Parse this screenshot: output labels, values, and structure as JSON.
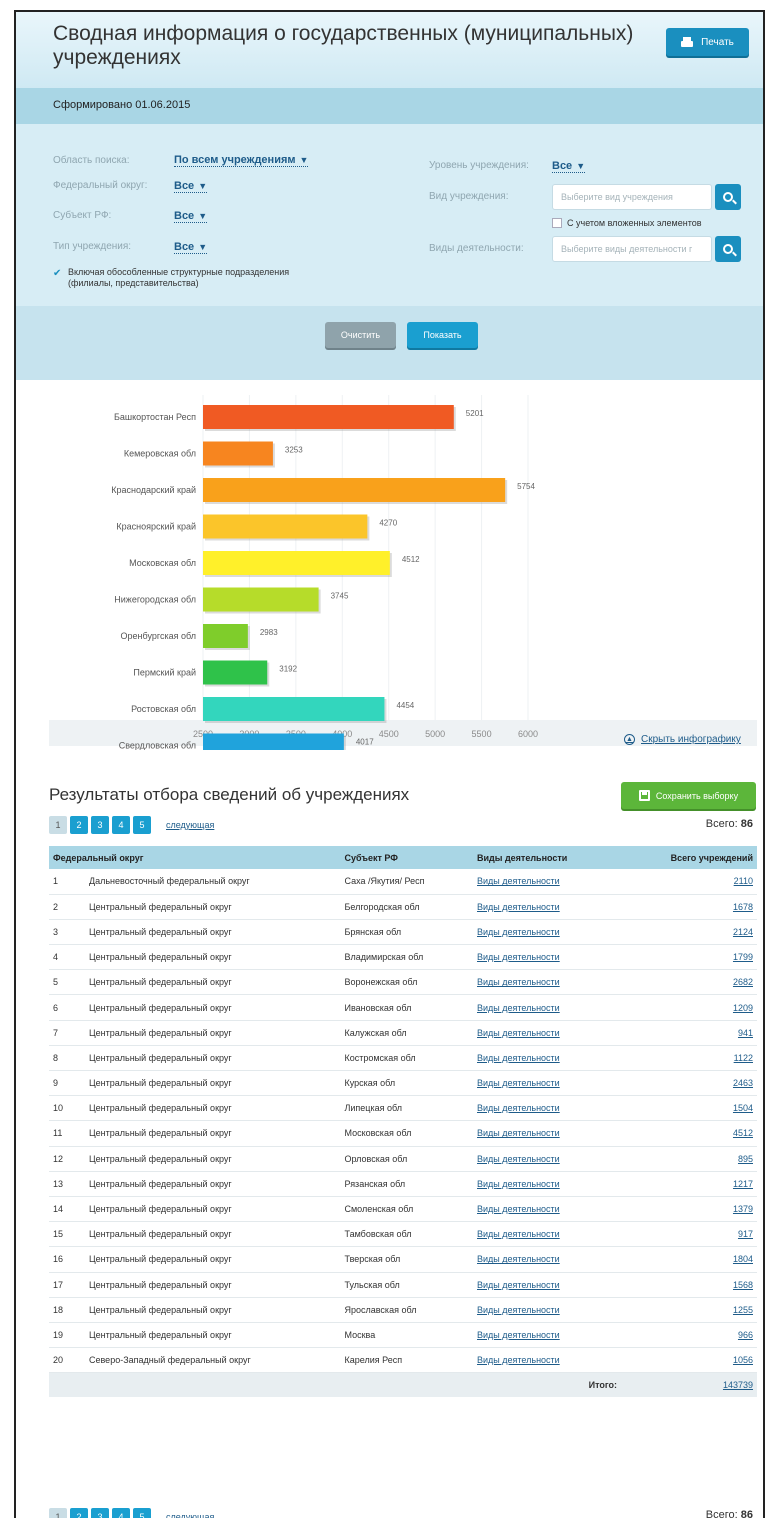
{
  "header": {
    "title": "Сводная информация о государственных (муниципальных) учреждениях",
    "print_label": "Печать"
  },
  "generated": "Сформировано 01.06.2015",
  "filters": {
    "search_area_label": "Область поиска:",
    "search_area_value": "По всем учреждениям",
    "federal_district_label": "Федеральный округ:",
    "federal_district_value": "Все",
    "subject_label": "Субъект РФ:",
    "subject_value": "Все",
    "type_label": "Тип учреждения:",
    "type_value": "Все",
    "level_label": "Уровень учреждения:",
    "level_value": "Все",
    "kind_label": "Вид учреждения:",
    "kind_placeholder": "Выберите вид учреждения",
    "nested_label": "С учетом вложенных элементов",
    "activity_label": "Виды деятельности:",
    "activity_placeholder": "Выберите виды деятельности г",
    "include_branches": "Включая обособленные структурные подразделения (филиалы, представительства)"
  },
  "actions": {
    "clear": "Очистить",
    "show": "Показать"
  },
  "chart_data": {
    "type": "bar",
    "orientation": "horizontal",
    "categories": [
      "Башкортостан Респ",
      "Кемеровская обл",
      "Краснодарский край",
      "Красноярский край",
      "Московская обл",
      "Нижегородская обл",
      "Оренбургская обл",
      "Пермский край",
      "Ростовская обл",
      "Свердловская обл"
    ],
    "values": [
      5201,
      3253,
      5754,
      4270,
      4512,
      3745,
      2983,
      3192,
      4454,
      4017
    ],
    "colors": [
      "#f05a23",
      "#f7851f",
      "#f9a11b",
      "#fbc52a",
      "#fff02a",
      "#b6dc2a",
      "#7fcd2b",
      "#2fc24a",
      "#33d6bd",
      "#20a3dc"
    ],
    "x_ticks": [
      "2500",
      "3000",
      "3500",
      "4000",
      "4500",
      "5000",
      "5500",
      "6000"
    ],
    "xlim": [
      2500,
      6000
    ]
  },
  "hide_infographic": "Скрыть инфографику",
  "results": {
    "title": "Результаты отбора сведений об учреждениях",
    "save_label": "Сохранить выборку",
    "pages": [
      "1",
      "2",
      "3",
      "4",
      "5"
    ],
    "next_label": "следующая",
    "total_label": "Всего:",
    "total_value": "86",
    "columns": [
      "Федеральный округ",
      "Субъект РФ",
      "Виды деятельности",
      "Всего учреждений"
    ],
    "rows": [
      [
        "1",
        "Дальневосточный федеральный округ",
        "Саха /Якутия/ Респ",
        "Виды деятельности",
        "2110"
      ],
      [
        "2",
        "Центральный федеральный округ",
        "Белгородская обл",
        "Виды деятельности",
        "1678"
      ],
      [
        "3",
        "Центральный федеральный округ",
        "Брянская обл",
        "Виды деятельности",
        "2124"
      ],
      [
        "4",
        "Центральный федеральный округ",
        "Владимирская обл",
        "Виды деятельности",
        "1799"
      ],
      [
        "5",
        "Центральный федеральный округ",
        "Воронежская обл",
        "Виды деятельности",
        "2682"
      ],
      [
        "6",
        "Центральный федеральный округ",
        "Ивановская обл",
        "Виды деятельности",
        "1209"
      ],
      [
        "7",
        "Центральный федеральный округ",
        "Калужская обл",
        "Виды деятельности",
        "941"
      ],
      [
        "8",
        "Центральный федеральный округ",
        "Костромская обл",
        "Виды деятельности",
        "1122"
      ],
      [
        "9",
        "Центральный федеральный округ",
        "Курская обл",
        "Виды деятельности",
        "2463"
      ],
      [
        "10",
        "Центральный федеральный округ",
        "Липецкая обл",
        "Виды деятельности",
        "1504"
      ],
      [
        "11",
        "Центральный федеральный округ",
        "Московская обл",
        "Виды деятельности",
        "4512"
      ],
      [
        "12",
        "Центральный федеральный округ",
        "Орловская обл",
        "Виды деятельности",
        "895"
      ],
      [
        "13",
        "Центральный федеральный округ",
        "Рязанская обл",
        "Виды деятельности",
        "1217"
      ],
      [
        "14",
        "Центральный федеральный округ",
        "Смоленская обл",
        "Виды деятельности",
        "1379"
      ],
      [
        "15",
        "Центральный федеральный округ",
        "Тамбовская обл",
        "Виды деятельности",
        "917"
      ],
      [
        "16",
        "Центральный федеральный округ",
        "Тверская обл",
        "Виды деятельности",
        "1804"
      ],
      [
        "17",
        "Центральный федеральный округ",
        "Тульская обл",
        "Виды деятельности",
        "1568"
      ],
      [
        "18",
        "Центральный федеральный округ",
        "Ярославская обл",
        "Виды деятельности",
        "1255"
      ],
      [
        "19",
        "Центральный федеральный округ",
        "Москва",
        "Виды деятельности",
        "966"
      ],
      [
        "20",
        "Северо-Западный федеральный округ",
        "Карелия Респ",
        "Виды деятельности",
        "1056"
      ]
    ],
    "sum_label": "Итого:",
    "sum_value": "143739"
  }
}
